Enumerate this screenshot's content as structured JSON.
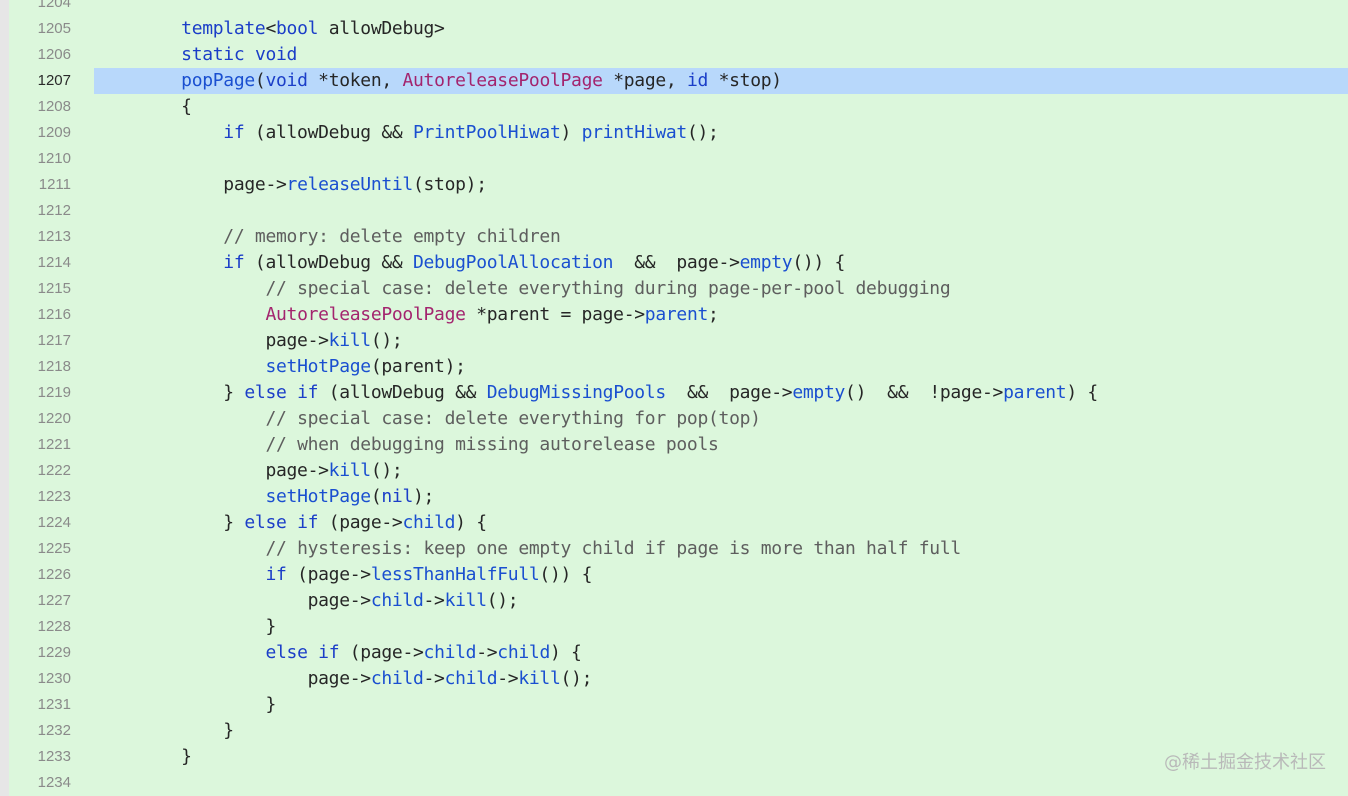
{
  "editor": {
    "current_line": "1207",
    "lines": [
      {
        "num": "1204",
        "tokens": []
      },
      {
        "num": "1205",
        "tokens": [
          {
            "t": "    "
          },
          {
            "t": "template",
            "c": "k"
          },
          {
            "t": "<"
          },
          {
            "t": "bool",
            "c": "k"
          },
          {
            "t": " allowDebug>"
          }
        ]
      },
      {
        "num": "1206",
        "tokens": [
          {
            "t": "    "
          },
          {
            "t": "static",
            "c": "k"
          },
          {
            "t": " "
          },
          {
            "t": "void",
            "c": "k"
          }
        ]
      },
      {
        "num": "1207",
        "tokens": [
          {
            "t": "    "
          },
          {
            "t": "popPage",
            "c": "f"
          },
          {
            "t": "("
          },
          {
            "t": "void",
            "c": "k"
          },
          {
            "t": " *token, "
          },
          {
            "t": "AutoreleasePoolPage",
            "c": "t"
          },
          {
            "t": " *page, "
          },
          {
            "t": "id",
            "c": "k"
          },
          {
            "t": " *stop)"
          }
        ]
      },
      {
        "num": "1208",
        "tokens": [
          {
            "t": "    {"
          }
        ]
      },
      {
        "num": "1209",
        "tokens": [
          {
            "t": "        "
          },
          {
            "t": "if",
            "c": "k"
          },
          {
            "t": " (allowDebug && "
          },
          {
            "t": "PrintPoolHiwat",
            "c": "f"
          },
          {
            "t": ") "
          },
          {
            "t": "printHiwat",
            "c": "f"
          },
          {
            "t": "();"
          }
        ]
      },
      {
        "num": "1210",
        "tokens": []
      },
      {
        "num": "1211",
        "tokens": [
          {
            "t": "        page->"
          },
          {
            "t": "releaseUntil",
            "c": "f"
          },
          {
            "t": "(stop);"
          }
        ]
      },
      {
        "num": "1212",
        "tokens": []
      },
      {
        "num": "1213",
        "tokens": [
          {
            "t": "        "
          },
          {
            "t": "// memory: delete empty children",
            "c": "c"
          }
        ]
      },
      {
        "num": "1214",
        "tokens": [
          {
            "t": "        "
          },
          {
            "t": "if",
            "c": "k"
          },
          {
            "t": " (allowDebug && "
          },
          {
            "t": "DebugPoolAllocation",
            "c": "f"
          },
          {
            "t": "  &&  page->"
          },
          {
            "t": "empty",
            "c": "f"
          },
          {
            "t": "()) {"
          }
        ]
      },
      {
        "num": "1215",
        "tokens": [
          {
            "t": "            "
          },
          {
            "t": "// special case: delete everything during page-per-pool debugging",
            "c": "c"
          }
        ]
      },
      {
        "num": "1216",
        "tokens": [
          {
            "t": "            "
          },
          {
            "t": "AutoreleasePoolPage",
            "c": "t"
          },
          {
            "t": " *parent = page->"
          },
          {
            "t": "parent",
            "c": "f"
          },
          {
            "t": ";"
          }
        ]
      },
      {
        "num": "1217",
        "tokens": [
          {
            "t": "            page->"
          },
          {
            "t": "kill",
            "c": "f"
          },
          {
            "t": "();"
          }
        ]
      },
      {
        "num": "1218",
        "tokens": [
          {
            "t": "            "
          },
          {
            "t": "setHotPage",
            "c": "f"
          },
          {
            "t": "(parent);"
          }
        ]
      },
      {
        "num": "1219",
        "tokens": [
          {
            "t": "        } "
          },
          {
            "t": "else",
            "c": "k"
          },
          {
            "t": " "
          },
          {
            "t": "if",
            "c": "k"
          },
          {
            "t": " (allowDebug && "
          },
          {
            "t": "DebugMissingPools",
            "c": "f"
          },
          {
            "t": "  &&  page->"
          },
          {
            "t": "empty",
            "c": "f"
          },
          {
            "t": "()  &&  !page->"
          },
          {
            "t": "parent",
            "c": "f"
          },
          {
            "t": ") {"
          }
        ]
      },
      {
        "num": "1220",
        "tokens": [
          {
            "t": "            "
          },
          {
            "t": "// special case: delete everything for pop(top)",
            "c": "c"
          }
        ]
      },
      {
        "num": "1221",
        "tokens": [
          {
            "t": "            "
          },
          {
            "t": "// when debugging missing autorelease pools",
            "c": "c"
          }
        ]
      },
      {
        "num": "1222",
        "tokens": [
          {
            "t": "            page->"
          },
          {
            "t": "kill",
            "c": "f"
          },
          {
            "t": "();"
          }
        ]
      },
      {
        "num": "1223",
        "tokens": [
          {
            "t": "            "
          },
          {
            "t": "setHotPage",
            "c": "f"
          },
          {
            "t": "("
          },
          {
            "t": "nil",
            "c": "k"
          },
          {
            "t": ");"
          }
        ]
      },
      {
        "num": "1224",
        "tokens": [
          {
            "t": "        } "
          },
          {
            "t": "else",
            "c": "k"
          },
          {
            "t": " "
          },
          {
            "t": "if",
            "c": "k"
          },
          {
            "t": " (page->"
          },
          {
            "t": "child",
            "c": "f"
          },
          {
            "t": ") {"
          }
        ]
      },
      {
        "num": "1225",
        "tokens": [
          {
            "t": "            "
          },
          {
            "t": "// hysteresis: keep one empty child if page is more than half full",
            "c": "c"
          }
        ]
      },
      {
        "num": "1226",
        "tokens": [
          {
            "t": "            "
          },
          {
            "t": "if",
            "c": "k"
          },
          {
            "t": " (page->"
          },
          {
            "t": "lessThanHalfFull",
            "c": "f"
          },
          {
            "t": "()) {"
          }
        ]
      },
      {
        "num": "1227",
        "tokens": [
          {
            "t": "                page->"
          },
          {
            "t": "child",
            "c": "f"
          },
          {
            "t": "->"
          },
          {
            "t": "kill",
            "c": "f"
          },
          {
            "t": "();"
          }
        ]
      },
      {
        "num": "1228",
        "tokens": [
          {
            "t": "            }"
          }
        ]
      },
      {
        "num": "1229",
        "tokens": [
          {
            "t": "            "
          },
          {
            "t": "else",
            "c": "k"
          },
          {
            "t": " "
          },
          {
            "t": "if",
            "c": "k"
          },
          {
            "t": " (page->"
          },
          {
            "t": "child",
            "c": "f"
          },
          {
            "t": "->"
          },
          {
            "t": "child",
            "c": "f"
          },
          {
            "t": ") {"
          }
        ]
      },
      {
        "num": "1230",
        "tokens": [
          {
            "t": "                page->"
          },
          {
            "t": "child",
            "c": "f"
          },
          {
            "t": "->"
          },
          {
            "t": "child",
            "c": "f"
          },
          {
            "t": "->"
          },
          {
            "t": "kill",
            "c": "f"
          },
          {
            "t": "();"
          }
        ]
      },
      {
        "num": "1231",
        "tokens": [
          {
            "t": "            }"
          }
        ]
      },
      {
        "num": "1232",
        "tokens": [
          {
            "t": "        }"
          }
        ]
      },
      {
        "num": "1233",
        "tokens": [
          {
            "t": "    }"
          }
        ]
      },
      {
        "num": "1234",
        "tokens": []
      }
    ]
  },
  "watermark": "@稀土掘金技术社区",
  "colors": {
    "background": "#dcf7dc",
    "current_line_highlight": "#b8d8fb",
    "keyword": "#1b3ec8",
    "type": "#a3246e",
    "comment": "#5e5e5e"
  }
}
